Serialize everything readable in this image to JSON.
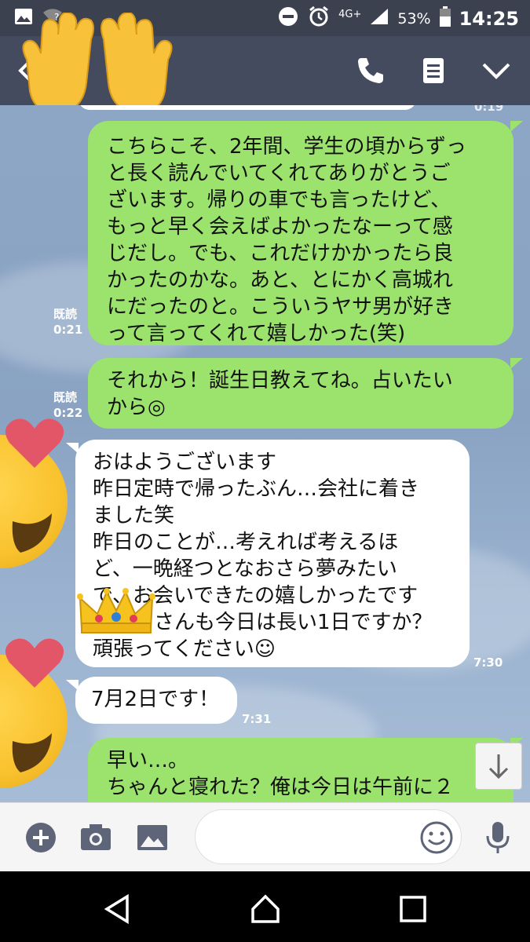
{
  "status_bar": {
    "network": "4G+",
    "battery_percent": "53%",
    "time": "14:25"
  },
  "header": {
    "icons": [
      "back-icon",
      "phone-icon",
      "notes-icon",
      "chevron-down-icon"
    ]
  },
  "messages": [
    {
      "id": "m0-time",
      "type": "partial-time",
      "text": "0:19"
    },
    {
      "id": "m1",
      "side": "sent",
      "text": "こちらこそ、2年間、学生の頃からずっ\nと長く読んでいてくれてありがとうご\nざいます。帰りの車でも言ったけど、\nもっと早く会えばよかったなーって感\nじだし。でも、これだけかかったら良\nかったのかな。あと、とにかく高城れ\nにだったのと。こういうヤサ男が好き\nって言ってくれて嬉しかった(笑)",
      "read_label": "既読",
      "time": "0:21"
    },
    {
      "id": "m2",
      "side": "sent",
      "text": "それから！誕生日教えてね。占いたい\nから◎",
      "read_label": "既読",
      "time": "0:22"
    },
    {
      "id": "m3",
      "side": "received",
      "text": "おはようございます\n昨日定時で帰ったぶん…会社に着き\nました笑\n昨日のことが…考えれば考えるほ\nど、一晩経つとなおさら夢みたい\nで、お会いできたの嬉しかったです\n　　　さんも今日は長い1日ですか？\n頑張ってください☺",
      "time": "7:30"
    },
    {
      "id": "m4",
      "side": "received",
      "text": "7月2日です！",
      "time": "7:31"
    },
    {
      "id": "m5",
      "side": "sent",
      "text": "早い…。\nちゃんと寝れた？俺は今日は午前に２"
    }
  ],
  "input_bar": {
    "icons": [
      "plus-icon",
      "camera-icon",
      "image-icon",
      "smile-icon",
      "mic-icon"
    ],
    "placeholder": ""
  },
  "nav_bar": {
    "icons": [
      "nav-back-icon",
      "nav-home-icon",
      "nav-recents-icon"
    ]
  },
  "colors": {
    "header_bg": "#454b5e",
    "status_bg": "#3c4150",
    "sent_bubble": "#9be36d",
    "received_bubble": "#ffffff",
    "chat_bg": "#8ea6c6"
  }
}
